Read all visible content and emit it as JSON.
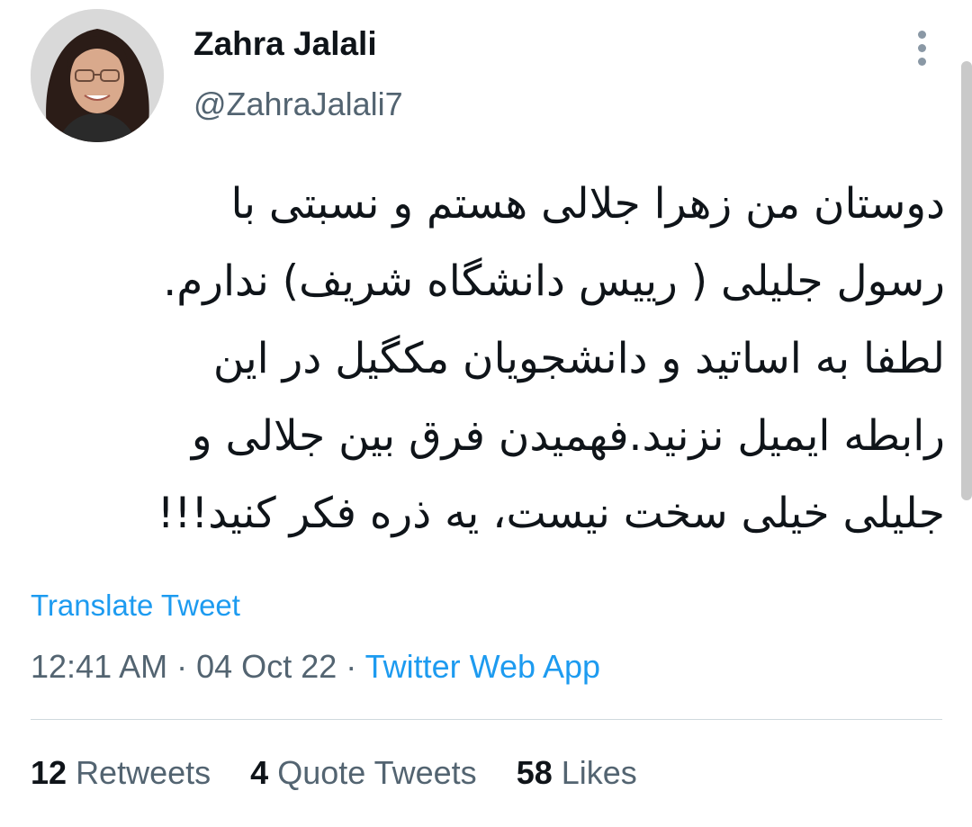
{
  "author": {
    "display_name": "Zahra Jalali",
    "handle": "@ZahraJalali7",
    "avatar_icon": "profile-photo"
  },
  "tweet": {
    "lines": [
      "دوستان من زهرا جلالی هستم و نسبتی با",
      "رسول جلیلی ( رییس دانشگاه شریف) ندارم.",
      "لطفا به اساتید و دانشجویان مکگیل در این",
      "رابطه ایمیل نزنید.فهمیدن فرق بین جلالی و",
      "جلیلی خیلی سخت نیست، یه ذره فکر کنید!!!"
    ],
    "translate_label": "Translate Tweet",
    "time": "12:41 AM",
    "date": "04 Oct 22",
    "separator": "·",
    "source": "Twitter Web App"
  },
  "stats": {
    "retweets_count": "12",
    "retweets_label": "Retweets",
    "quotes_count": "4",
    "quotes_label": "Quote Tweets",
    "likes_count": "58",
    "likes_label": "Likes"
  },
  "colors": {
    "link": "#1d9bf0",
    "secondary_text": "#536471",
    "primary_text": "#0f1419",
    "divider": "#cfd9de"
  },
  "icons": {
    "more": "more-vertical-icon"
  }
}
